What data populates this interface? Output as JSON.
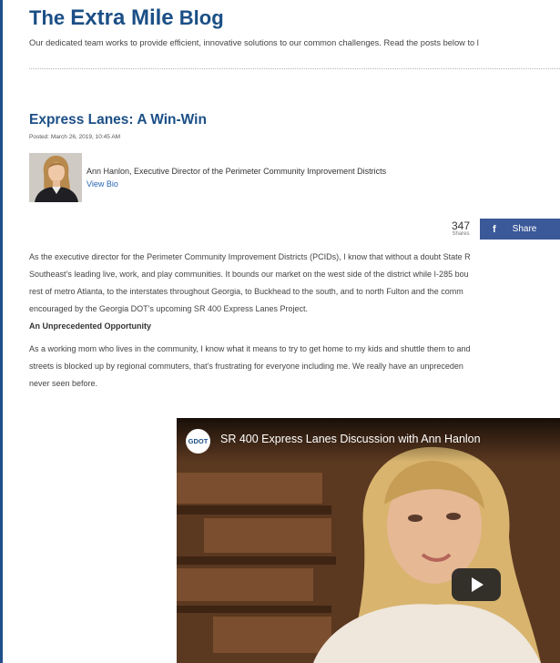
{
  "header": {
    "title_prefix": "The",
    "title_brand": "Extra Mile",
    "title_suffix": "Blog",
    "tagline": "Our dedicated team works to provide efficient, innovative solutions to our common challenges. Read the posts below to l"
  },
  "post": {
    "title": "Express Lanes: A Win-Win",
    "posted": "Posted: March 26, 2019, 10:45 AM",
    "author": "Ann Hanlon, Executive Director of the Perimeter Community Improvement Districts",
    "view_bio": "View Bio",
    "share": {
      "count": "347",
      "count_label": "Shares",
      "icon": "f",
      "label": "Share"
    },
    "paragraph1": [
      "As the executive director for the Perimeter Community Improvement Districts (PCIDs), I know that without a doubt State R",
      "Southeast’s leading live, work, and play communities. It bounds our market on the west side of the district while I-285 bou",
      "rest of metro Atlanta, to the interstates throughout Georgia, to Buckhead to the south, and to north Fulton and the comm",
      "encouraged by the Georgia DOT’s upcoming SR 400 Express Lanes Project."
    ],
    "subheading": "An Unprecedented Opportunity",
    "paragraph2": [
      "As a working mom who lives in the community, I know what it means to try to get home to my kids and shuttle them to and",
      "streets is blocked up by regional commuters, that’s frustrating for everyone including me. We really have an unpreceden",
      "never seen before."
    ]
  },
  "video": {
    "logo": "GDOT",
    "title": "SR 400 Express Lanes Discussion with Ann Hanlon"
  },
  "colors": {
    "brand_blue": "#1b4f86",
    "link_blue": "#2a66b3",
    "facebook_blue": "#3b5998"
  }
}
